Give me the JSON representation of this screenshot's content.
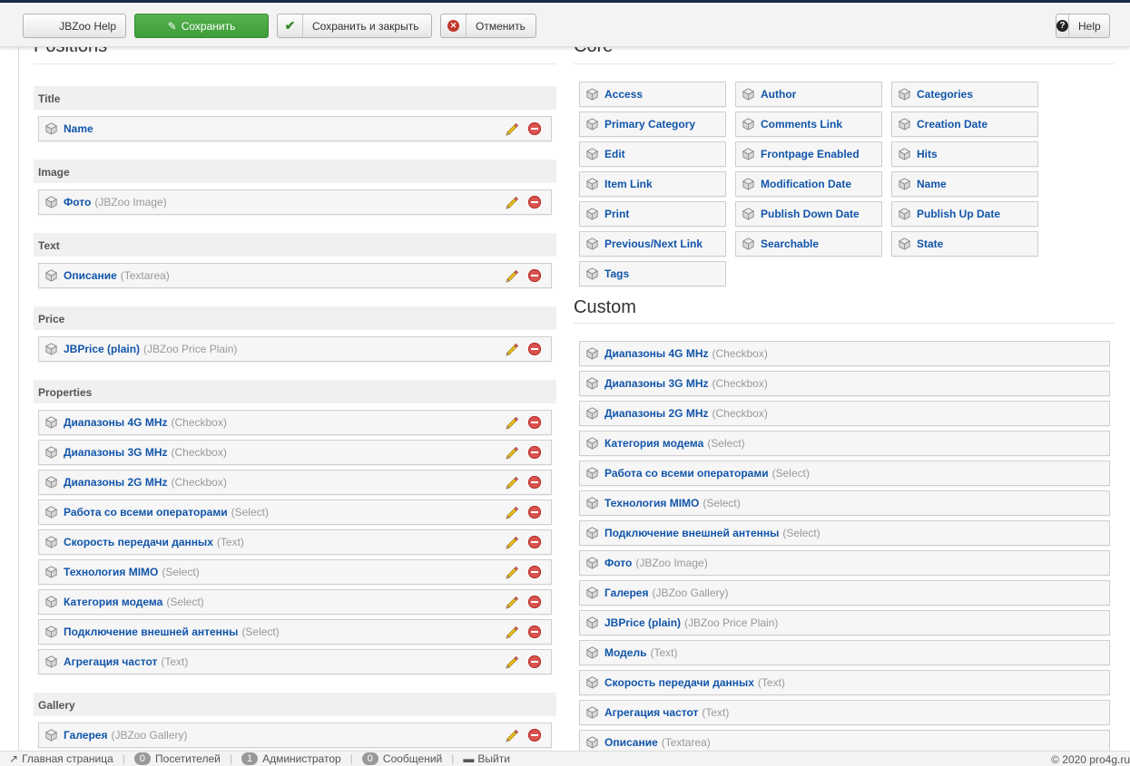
{
  "toolbar": {
    "help_label": "JBZoo Help",
    "save_label": "Сохранить",
    "save_close_label": "Сохранить и закрыть",
    "cancel_label": "Отменить",
    "help_right_label": "Help"
  },
  "positions": {
    "title": "Positions",
    "groups": [
      {
        "label": "Title",
        "items": [
          {
            "name": "Name",
            "type": ""
          }
        ]
      },
      {
        "label": "Image",
        "items": [
          {
            "name": "Фото",
            "type": "(JBZoo Image)"
          }
        ]
      },
      {
        "label": "Text",
        "items": [
          {
            "name": "Описание",
            "type": "(Textarea)"
          }
        ]
      },
      {
        "label": "Price",
        "items": [
          {
            "name": "JBPrice (plain)",
            "type": "(JBZoo Price Plain)"
          }
        ]
      },
      {
        "label": "Properties",
        "items": [
          {
            "name": "Диапазоны 4G MHz",
            "type": "(Checkbox)"
          },
          {
            "name": "Диапазоны 3G MHz",
            "type": "(Checkbox)"
          },
          {
            "name": "Диапазоны 2G MHz",
            "type": "(Checkbox)"
          },
          {
            "name": "Работа со всеми операторами",
            "type": "(Select)"
          },
          {
            "name": "Скорость передачи данных",
            "type": "(Text)"
          },
          {
            "name": "Технология MIMO",
            "type": "(Select)"
          },
          {
            "name": "Категория модема",
            "type": "(Select)"
          },
          {
            "name": "Подключение внешней антенны",
            "type": "(Select)"
          },
          {
            "name": "Агрегация частот",
            "type": "(Text)"
          }
        ]
      },
      {
        "label": "Gallery",
        "items": [
          {
            "name": "Галерея",
            "type": "(JBZoo Gallery)"
          }
        ]
      }
    ]
  },
  "core": {
    "title": "Core",
    "items": [
      "Access",
      "Author",
      "Categories",
      "Primary Category",
      "Comments Link",
      "Creation Date",
      "Edit",
      "Frontpage Enabled",
      "Hits",
      "Item Link",
      "Modification Date",
      "Name",
      "Print",
      "Publish Down Date",
      "Publish Up Date",
      "Previous/Next Link",
      "Searchable",
      "State",
      "Tags"
    ]
  },
  "custom": {
    "title": "Custom",
    "items": [
      {
        "name": "Диапазоны 4G MHz",
        "type": "(Checkbox)"
      },
      {
        "name": "Диапазоны 3G MHz",
        "type": "(Checkbox)"
      },
      {
        "name": "Диапазоны 2G MHz",
        "type": "(Checkbox)"
      },
      {
        "name": "Категория модема",
        "type": "(Select)"
      },
      {
        "name": "Работа со всеми операторами",
        "type": "(Select)"
      },
      {
        "name": "Технология MIMO",
        "type": "(Select)"
      },
      {
        "name": "Подключение внешней антенны",
        "type": "(Select)"
      },
      {
        "name": "Фото",
        "type": "(JBZoo Image)"
      },
      {
        "name": "Галерея",
        "type": "(JBZoo Gallery)"
      },
      {
        "name": "JBPrice (plain)",
        "type": "(JBZoo Price Plain)"
      },
      {
        "name": "Модель",
        "type": "(Text)"
      },
      {
        "name": "Скорость передачи данных",
        "type": "(Text)"
      },
      {
        "name": "Агрегация частот",
        "type": "(Text)"
      },
      {
        "name": "Описание",
        "type": "(Textarea)"
      }
    ]
  },
  "footer": {
    "home_label": "Главная страница",
    "visitors_count": "0",
    "visitors_label": "Посетителей",
    "admins_count": "1",
    "admins_label": "Администратор",
    "messages_count": "0",
    "messages_label": "Сообщений",
    "logout_label": "Выйти",
    "copyright": "© 2020 pro4g.ru"
  },
  "colors": {
    "link": "#1155aa",
    "save_green": "#4aa845",
    "delete_red": "#d9534f",
    "toolbar_bg": "#f3f3f3"
  }
}
